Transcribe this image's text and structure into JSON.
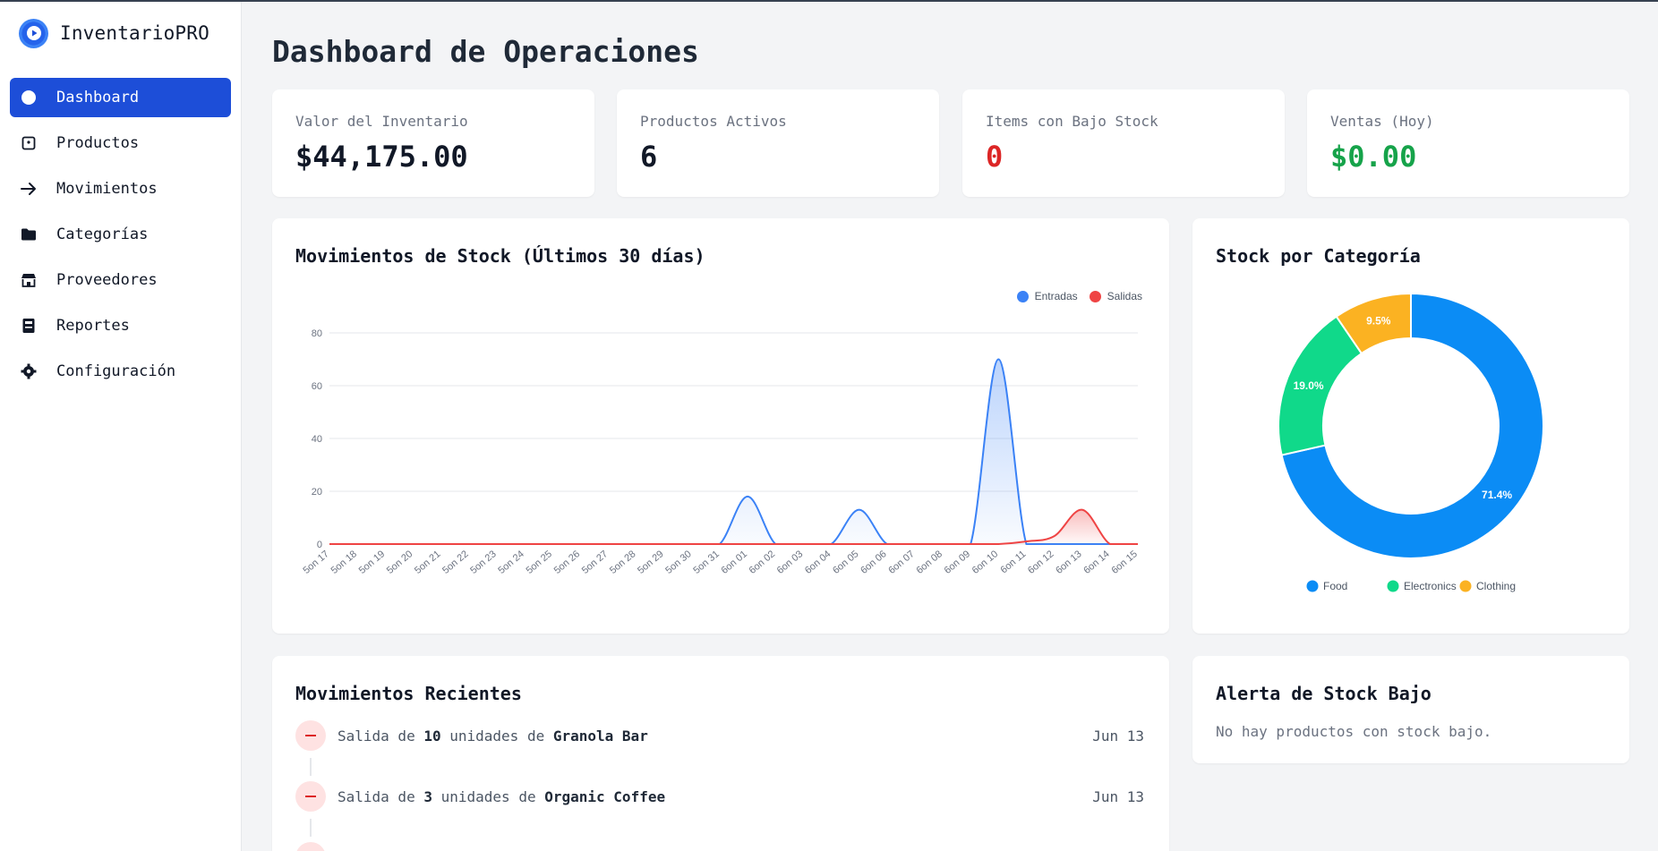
{
  "app": {
    "name": "InventarioPRO"
  },
  "sidebar": {
    "items": [
      {
        "label": "Dashboard",
        "icon": "circle-icon",
        "active": true
      },
      {
        "label": "Productos",
        "icon": "box-icon",
        "active": false
      },
      {
        "label": "Movimientos",
        "icon": "arrow-right-icon",
        "active": false
      },
      {
        "label": "Categorías",
        "icon": "folder-icon",
        "active": false
      },
      {
        "label": "Proveedores",
        "icon": "store-icon",
        "active": false
      },
      {
        "label": "Reportes",
        "icon": "report-icon",
        "active": false
      },
      {
        "label": "Configuración",
        "icon": "gear-icon",
        "active": false
      }
    ]
  },
  "page": {
    "title": "Dashboard de Operaciones"
  },
  "stats": [
    {
      "label": "Valor del Inventario",
      "value": "$44,175.00",
      "color": "#111827"
    },
    {
      "label": "Productos Activos",
      "value": "6",
      "color": "#111827"
    },
    {
      "label": "Items con Bajo Stock",
      "value": "0",
      "color": "#dc2626"
    },
    {
      "label": "Ventas (Hoy)",
      "value": "$0.00",
      "color": "#16a34a"
    }
  ],
  "movements_chart": {
    "title": "Movimientos de Stock (Últimos 30 días)",
    "legend": [
      "Entradas",
      "Salidas"
    ]
  },
  "category_chart": {
    "title": "Stock por Categoría"
  },
  "chart_data": [
    {
      "type": "area",
      "title": "Movimientos de Stock (Últimos 30 días)",
      "categories": [
        "5on 17",
        "5on 18",
        "5on 19",
        "5on 20",
        "5on 21",
        "5on 22",
        "5on 23",
        "5on 24",
        "5on 25",
        "5on 26",
        "5on 27",
        "5on 28",
        "5on 29",
        "5on 30",
        "5on 31",
        "6on 01",
        "6on 02",
        "6on 03",
        "6on 04",
        "6on 05",
        "6on 06",
        "6on 07",
        "6on 08",
        "6on 09",
        "6on 10",
        "6on 11",
        "6on 12",
        "6on 13",
        "6on 14",
        "6on 15"
      ],
      "series": [
        {
          "name": "Entradas",
          "color": "#3b82f6",
          "values": [
            0,
            0,
            0,
            0,
            0,
            0,
            0,
            0,
            0,
            0,
            0,
            0,
            0,
            0,
            0,
            18,
            0,
            0,
            0,
            13,
            0,
            0,
            0,
            0,
            70,
            0,
            0,
            0,
            0,
            0
          ]
        },
        {
          "name": "Salidas",
          "color": "#ef4444",
          "values": [
            0,
            0,
            0,
            0,
            0,
            0,
            0,
            0,
            0,
            0,
            0,
            0,
            0,
            0,
            0,
            0,
            0,
            0,
            0,
            0,
            0,
            0,
            0,
            0,
            0,
            1,
            3,
            13,
            0,
            0
          ]
        }
      ],
      "ylim": [
        0,
        80
      ],
      "yticks": [
        0,
        20,
        40,
        60,
        80
      ],
      "grid": true,
      "legend_position": "top-right"
    },
    {
      "type": "pie",
      "title": "Stock por Categoría",
      "categories": [
        "Food",
        "Electronics",
        "Clothing"
      ],
      "values": [
        71.4,
        19.0,
        9.5
      ],
      "labels": [
        "71.4%",
        "19.0%",
        "9.5%"
      ],
      "colors": [
        "#0b8cf5",
        "#10d98a",
        "#fbb222"
      ],
      "legend_position": "bottom"
    }
  ],
  "recent": {
    "title": "Movimientos Recientes",
    "items": [
      {
        "prefix": "Salida de",
        "qty": "10",
        "mid": "unidades de",
        "product": "Granola Bar",
        "date": "Jun 13"
      },
      {
        "prefix": "Salida de",
        "qty": "3",
        "mid": "unidades de",
        "product": "Organic Coffee",
        "date": "Jun 13"
      }
    ]
  },
  "low_stock": {
    "title": "Alerta de Stock Bajo",
    "message": "No hay productos con stock bajo."
  }
}
